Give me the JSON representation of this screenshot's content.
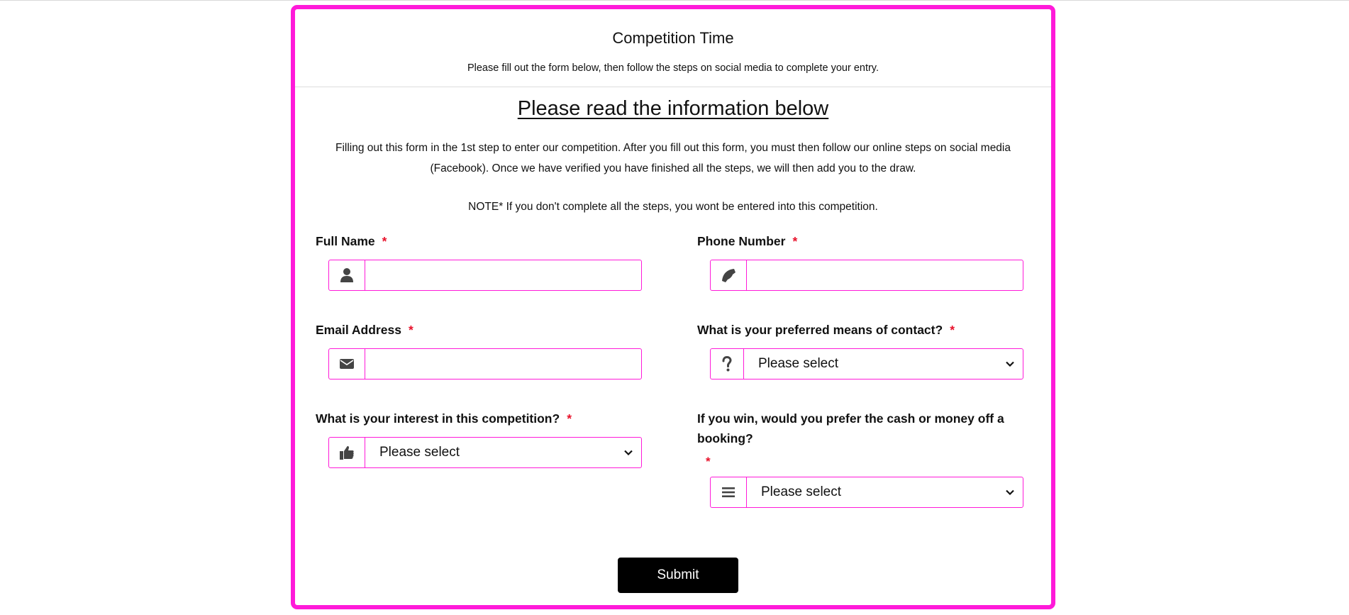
{
  "colors": {
    "accent": "#ff1ad9",
    "required": "#e8122b",
    "button_bg": "#000000",
    "button_text": "#ffffff"
  },
  "form": {
    "title": "Competition Time",
    "subtitle": "Please fill out the form below, then follow the steps on social media to complete your entry.",
    "info_heading": "Please read the information below",
    "info_paragraph": "Filling out this form in the 1st step to enter our competition. After you fill out this form, you must then follow our online steps on social media (Facebook). Once we have verified you have finished all the steps, we will then add you to the draw.",
    "note": "NOTE* If you don't complete all the steps, you wont be entered into this competition.",
    "required_mark": "*",
    "submit_label": "Submit"
  },
  "fields": {
    "full_name": {
      "label": "Full Name",
      "icon": "user-icon",
      "value": "",
      "placeholder": ""
    },
    "phone": {
      "label": "Phone Number",
      "icon": "phone-icon",
      "value": "",
      "placeholder": ""
    },
    "email": {
      "label": "Email Address",
      "icon": "envelope-icon",
      "value": "",
      "placeholder": ""
    },
    "contact_means": {
      "label": "What is your preferred means of contact?",
      "icon": "question-icon",
      "selected": "Please select"
    },
    "interest": {
      "label": "What is your interest in this competition?",
      "icon": "thumbs-up-icon",
      "selected": "Please select"
    },
    "prize": {
      "label": "If you win, would you prefer the cash or money off a booking?",
      "icon": "bars-icon",
      "selected": "Please select"
    }
  }
}
